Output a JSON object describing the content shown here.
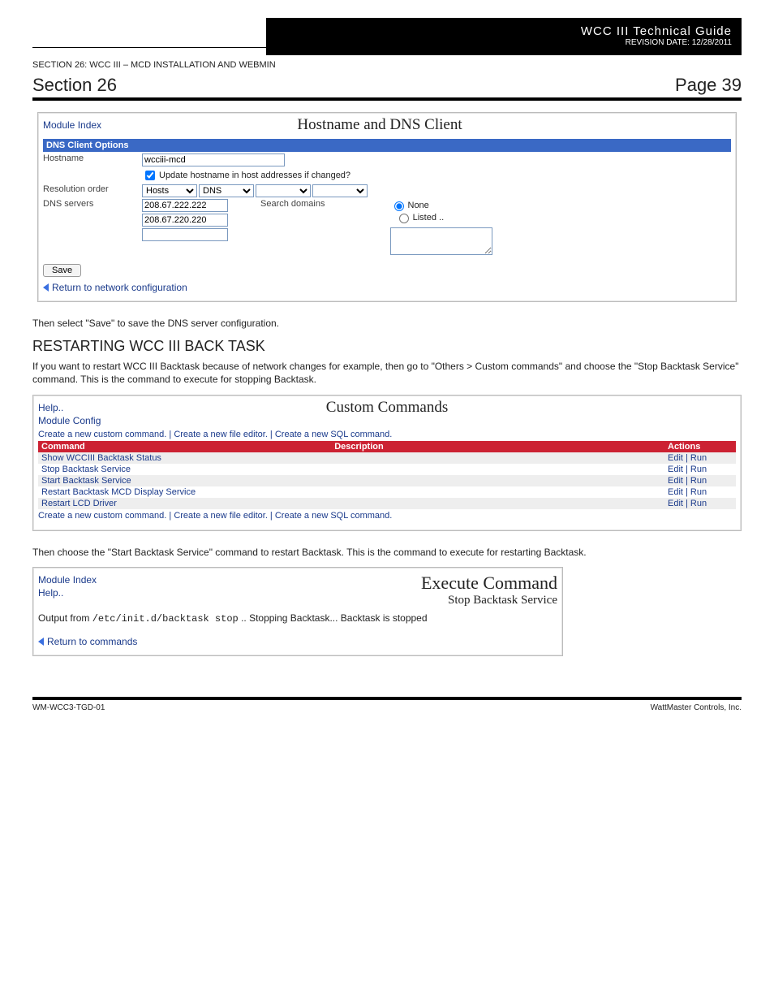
{
  "header": {
    "brand_line1": "WCC III Technical Guide",
    "brand_line2": "REVISION DATE: 12/28/2011",
    "crumb": "SECTION 26:  WCC III – MCD INSTALLATION AND WEBMIN",
    "section_left": "Section 26",
    "section_right": "Page 39"
  },
  "dns_panel": {
    "module_index_label": "Module Index",
    "title": "Hostname and DNS Client",
    "bar": "DNS Client Options",
    "row_hostname": "Hostname",
    "hostname_value": "wcciii-mcd",
    "update_checkbox_label": "Update hostname in host addresses if changed?",
    "row_resolution": "Resolution order",
    "resolution_opts": [
      "Hosts",
      "DNS"
    ],
    "row_dns": "DNS servers",
    "dns1": "208.67.222.222",
    "dns2": "208.67.220.220",
    "search_domains_label": "Search domains",
    "sd_radio_none": "None",
    "sd_radio_listed": "Listed ..",
    "save_btn": "Save",
    "return_link": "Return to network configuration"
  },
  "txt": {
    "para1": "Then select \"Save\" to save the DNS server configuration.",
    "h3_restart": "RESTARTING WCC III BACK TASK",
    "para2": "If you want to restart WCC III Backtask because of network changes for example, then go to \"Others > Custom commands\" and choose the \"Stop Backtask Service\" command. This is the command to execute for stopping Backtask.",
    "para3": "Then choose the \"Start Backtask Service\" command to restart Backtask. This is the command to execute for restarting Backtask."
  },
  "cc_panel": {
    "help_label": "Help..",
    "module_config_label": "Module Config",
    "title": "Custom Commands",
    "links_line": "Create a new custom command.  |  Create a new file editor.  |  Create a new SQL command.",
    "col_command": "Command",
    "col_description": "Description",
    "col_actions": "Actions",
    "rows": [
      {
        "cmd": "Show WCCIII Backtask Status",
        "act": "Edit  |  Run"
      },
      {
        "cmd": "Stop Backtask Service",
        "act": "Edit  |  Run"
      },
      {
        "cmd": "Start Backtask Service",
        "act": "Edit  |  Run"
      },
      {
        "cmd": "Restart Backtask MCD Display Service",
        "act": "Edit  |  Run"
      },
      {
        "cmd": "Restart LCD Driver",
        "act": "Edit  |  Run"
      }
    ]
  },
  "exec_panel": {
    "module_index": "Module Index",
    "help": "Help..",
    "title": "Execute Command",
    "subtitle": "Stop Backtask Service",
    "out_prefix": "Output from ",
    "out_cmd": "/etc/init.d/backtask stop",
    "out_suffix": " ..  Stopping Backtask...  Backtask is stopped",
    "return_link": "Return to commands"
  },
  "footer": {
    "left": "WM-WCC3-TGD-01",
    "right": "WattMaster Controls, Inc."
  }
}
